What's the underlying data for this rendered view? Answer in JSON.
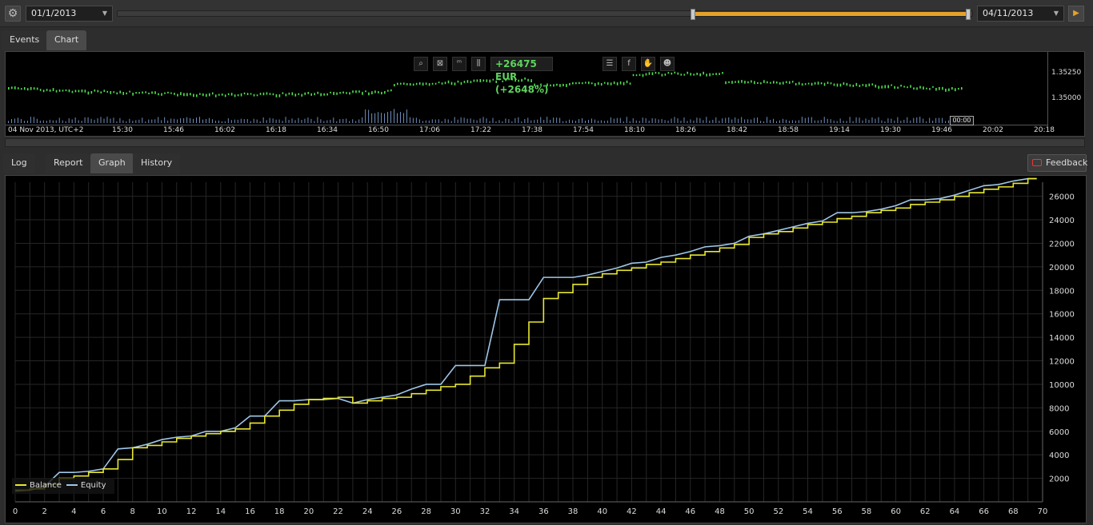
{
  "toolbar": {
    "settings_icon": "gear-icon",
    "start_date": "01/1/2013",
    "end_date": "04/11/2013",
    "range_fill_start": 0.673,
    "range_fill_end": 0.995,
    "play_icon": "play-icon"
  },
  "top_tabs": [
    {
      "label": "Events",
      "active": false
    },
    {
      "label": "Chart",
      "active": true
    }
  ],
  "price_chart": {
    "pnl_text": "+26475 EUR (+2648%)",
    "price_ticks": [
      "1.35250",
      "1.35000"
    ],
    "time_labels": [
      "04 Nov 2013, UTC+2",
      "15:30",
      "15:46",
      "16:02",
      "16:18",
      "16:34",
      "16:50",
      "17:06",
      "17:22",
      "17:38",
      "17:54",
      "18:10",
      "18:26",
      "18:42",
      "18:58",
      "19:14",
      "19:30",
      "19:46",
      "20:02",
      "20:18"
    ],
    "cursor_label": "00:00",
    "toolbar_icons": [
      "zoom-icon",
      "chart-settings-icon",
      "m1-timeframe-icon",
      "candles-icon",
      "checklist-icon",
      "facebook-icon",
      "thumbs-icon",
      "person-icon"
    ]
  },
  "bottom_tabs": [
    {
      "label": "Log",
      "active": false
    },
    {
      "label": "Report",
      "active": false
    },
    {
      "label": "Graph",
      "active": true
    },
    {
      "label": "History",
      "active": false
    }
  ],
  "feedback": {
    "label": "Feedback",
    "icon": "feedback-icon"
  },
  "chart_data": {
    "type": "line",
    "xlim": [
      0,
      70
    ],
    "ylim": [
      0,
      27200
    ],
    "x_ticks": [
      0,
      2,
      4,
      6,
      8,
      10,
      12,
      14,
      16,
      18,
      20,
      22,
      24,
      26,
      28,
      30,
      32,
      34,
      36,
      38,
      40,
      42,
      44,
      46,
      48,
      50,
      52,
      54,
      56,
      58,
      60,
      62,
      64,
      66,
      68,
      70
    ],
    "y_ticks": [
      2000,
      4000,
      6000,
      8000,
      10000,
      12000,
      14000,
      16000,
      18000,
      20000,
      22000,
      24000,
      26000
    ],
    "legend_position": "bottom-left",
    "grid": true,
    "series": [
      {
        "name": "Balance",
        "color": "#e8e830",
        "step": true,
        "x": [
          0,
          1,
          2,
          3,
          4,
          5,
          6,
          7,
          8,
          9,
          10,
          11,
          12,
          13,
          14,
          15,
          16,
          17,
          18,
          19,
          20,
          21,
          22,
          23,
          24,
          25,
          26,
          27,
          28,
          29,
          30,
          31,
          32,
          33,
          34,
          35,
          36,
          37,
          38,
          39,
          40,
          41,
          42,
          43,
          44,
          45,
          46,
          47,
          48,
          49,
          50,
          51,
          52,
          53,
          54,
          55,
          56,
          57,
          58,
          59,
          60,
          61,
          62,
          63,
          64,
          65,
          66,
          67,
          68,
          69
        ],
        "values": [
          1000,
          1100,
          1500,
          2000,
          2200,
          2500,
          2800,
          3600,
          4600,
          4800,
          5100,
          5400,
          5600,
          5800,
          6000,
          6200,
          6700,
          7300,
          7800,
          8300,
          8700,
          8800,
          8900,
          8400,
          8600,
          8800,
          8900,
          9200,
          9500,
          9800,
          10000,
          10700,
          11400,
          11800,
          13400,
          15300,
          17300,
          17800,
          18500,
          19100,
          19400,
          19700,
          19900,
          20200,
          20400,
          20700,
          21000,
          21300,
          21600,
          21900,
          22500,
          22800,
          23000,
          23300,
          23600,
          23800,
          24100,
          24300,
          24600,
          24800,
          25000,
          25300,
          25500,
          25700,
          26000,
          26300,
          26600,
          26800,
          27100,
          27500
        ]
      },
      {
        "name": "Equity",
        "color": "#9fc6e8",
        "step": false,
        "x": [
          0,
          1,
          2,
          3,
          4,
          5,
          6,
          7,
          8,
          9,
          10,
          11,
          12,
          13,
          14,
          15,
          16,
          17,
          18,
          19,
          20,
          21,
          22,
          23,
          24,
          25,
          26,
          27,
          28,
          29,
          30,
          31,
          32,
          33,
          34,
          35,
          36,
          37,
          38,
          39,
          40,
          41,
          42,
          43,
          44,
          45,
          46,
          47,
          48,
          49,
          50,
          51,
          52,
          53,
          54,
          55,
          56,
          57,
          58,
          59,
          60,
          61,
          62,
          63,
          64,
          65,
          66,
          67,
          68,
          69
        ],
        "values": [
          900,
          1000,
          1300,
          2500,
          2500,
          2600,
          2800,
          4500,
          4600,
          4900,
          5300,
          5500,
          5600,
          6000,
          6000,
          6300,
          7300,
          7300,
          8600,
          8600,
          8700,
          8700,
          8800,
          8400,
          8700,
          8900,
          9100,
          9600,
          10000,
          10000,
          11600,
          11600,
          11600,
          17200,
          17200,
          17200,
          19100,
          19100,
          19100,
          19300,
          19600,
          19900,
          20300,
          20400,
          20800,
          21000,
          21300,
          21700,
          21800,
          22000,
          22600,
          22800,
          23100,
          23400,
          23700,
          23900,
          24600,
          24600,
          24700,
          24900,
          25200,
          25700,
          25700,
          25800,
          26100,
          26500,
          26900,
          27000,
          27300,
          27500
        ]
      }
    ]
  }
}
